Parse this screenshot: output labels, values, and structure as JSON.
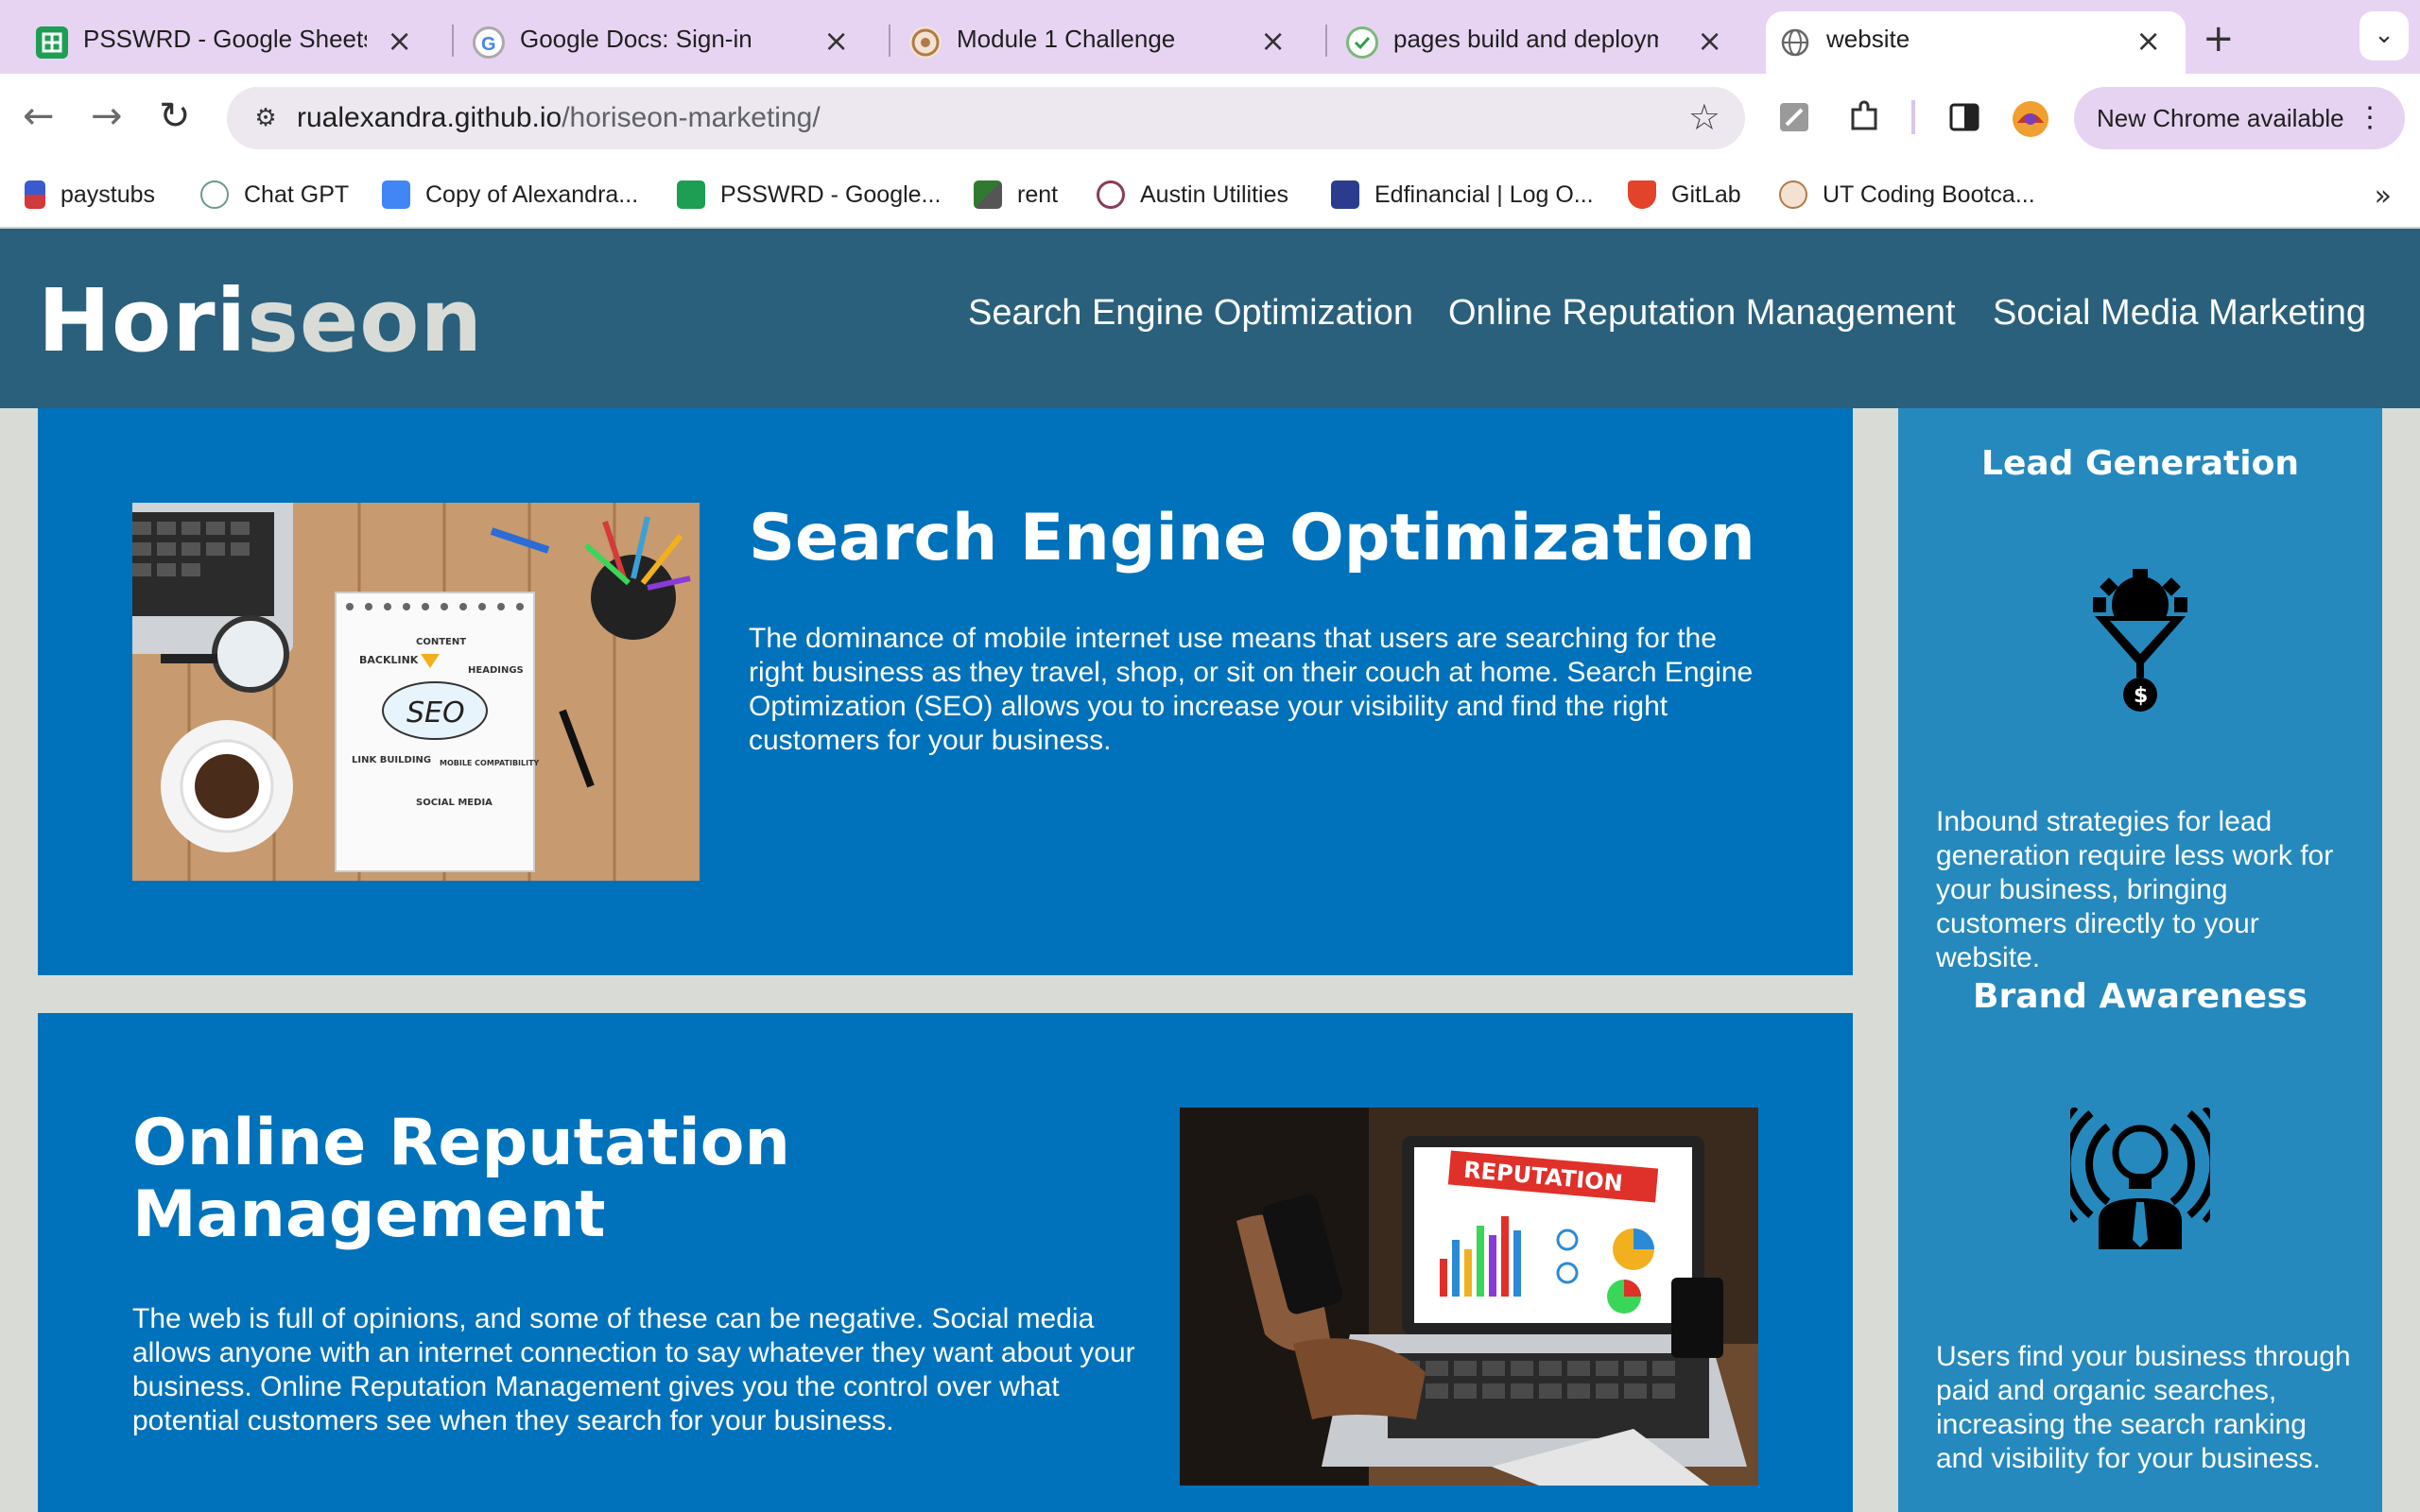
{
  "browser": {
    "tabs": [
      {
        "title": "PSSWRD - Google Sheets",
        "icon": "sheets-icon"
      },
      {
        "title": "Google Docs: Sign-in",
        "icon": "google-icon"
      },
      {
        "title": "Module 1 Challenge",
        "icon": "bootcamp-icon"
      },
      {
        "title": "pages build and deployment",
        "icon": "github-actions-icon"
      },
      {
        "title": "website",
        "icon": "globe-icon"
      }
    ],
    "url_host": "rualexandra.github.io",
    "url_path": "/horiseon-marketing/",
    "update_label": "New Chrome available",
    "bookmarks": [
      "paystubs",
      "Chat GPT",
      "Copy of Alexandra...",
      "PSSWRD - Google...",
      "rent",
      "Austin Utilities",
      "Edfinancial | Log O...",
      "GitLab",
      "UT Coding Bootca..."
    ]
  },
  "site": {
    "logo_main": "Hori",
    "logo_accent": "seon",
    "nav": [
      "Search Engine Optimization",
      "Online Reputation Management",
      "Social Media Marketing"
    ]
  },
  "content": {
    "seo": {
      "title": "Search Engine Optimization",
      "body": "The dominance of mobile internet use means that users are searching for the right business as they travel, shop, or sit on their couch at home. Search Engine Optimization (SEO) allows you to increase your visibility and find the right customers for your business.",
      "image_words": [
        "CONTENT",
        "BACKLINK",
        "HEADINGS",
        "SEO",
        "LINK BUILDING",
        "MOBILE COMPATIBILITY",
        "SOCIAL MEDIA"
      ]
    },
    "orm": {
      "title_line1": "Online Reputation",
      "title_line2": "Management",
      "body": "The web is full of opinions, and some of these can be negative. Social media allows anyone with an internet connection to say whatever they want about your business. Online Reputation Management gives you the control over what potential customers see when they search for your business.",
      "image_words": [
        "REPUTATION"
      ]
    }
  },
  "aside": {
    "lead_title": "Lead Generation",
    "lead_body": "Inbound strategies for lead generation require less work for your business, bringing customers directly to your website.",
    "brand_title": "Brand Awareness",
    "brand_body": "Users find your business through paid and organic searches, increasing the search ranking and visibility for your business."
  },
  "colors": {
    "header": "#2a607c",
    "card": "#0072bb",
    "aside": "#2589bd",
    "page_bg": "#d9dcd6"
  }
}
